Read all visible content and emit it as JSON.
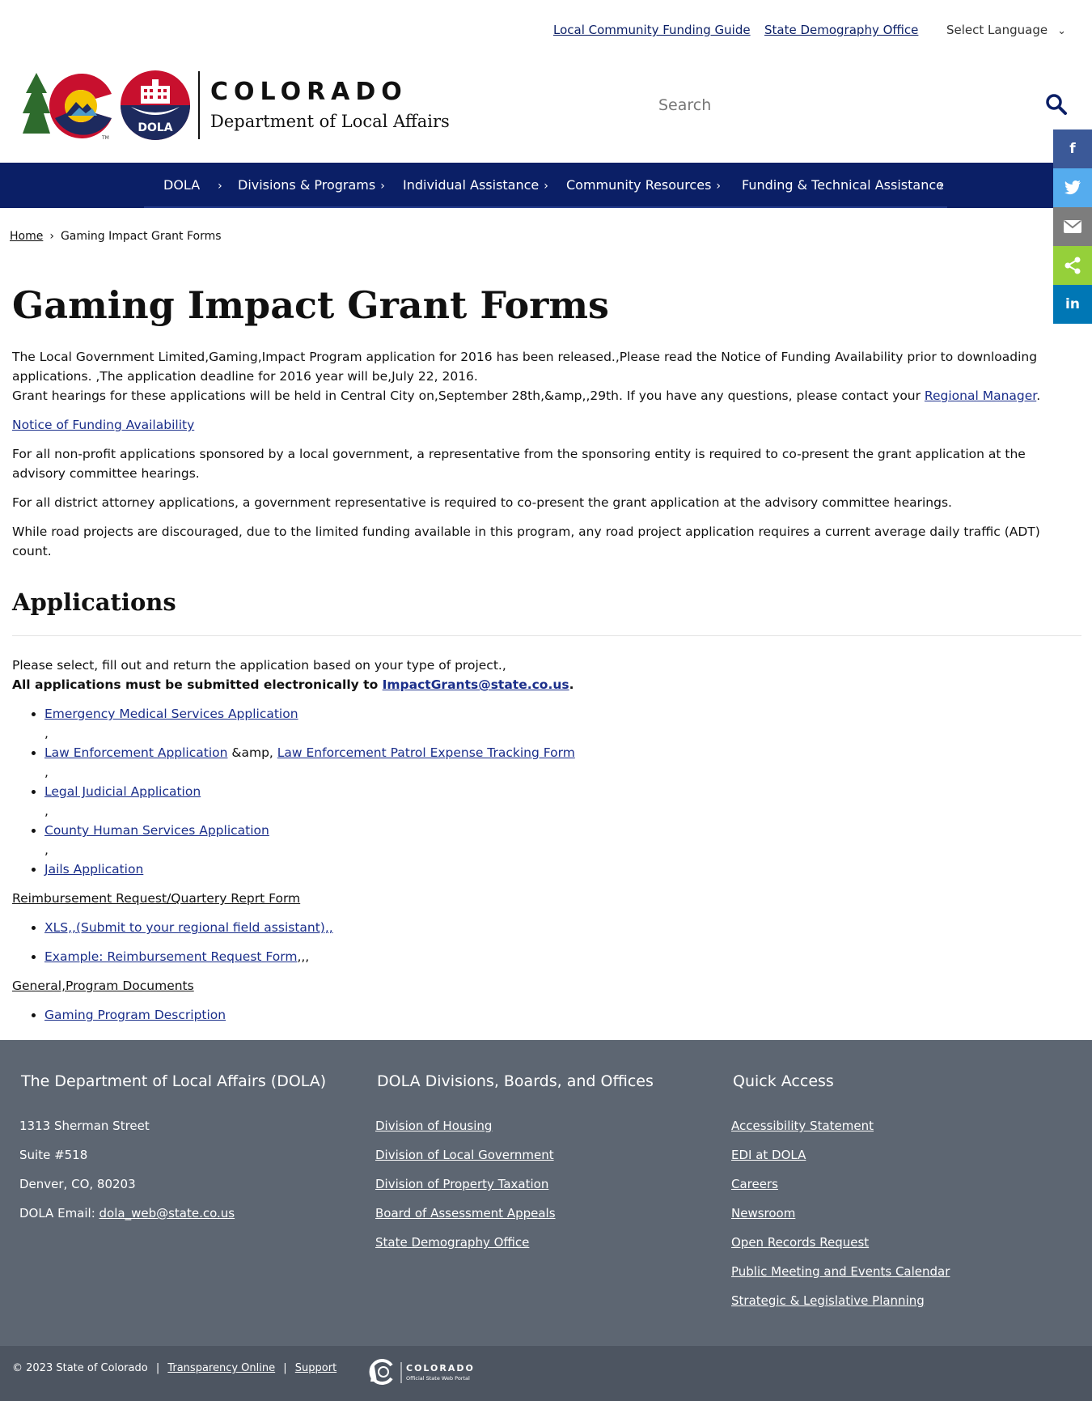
{
  "utility": {
    "link1": "Local Community Funding Guide",
    "link2": "State Demography Office",
    "language": "Select Language"
  },
  "header": {
    "wordmark": "COLORADO",
    "department": "Department of Local Affairs",
    "seal_text": "DOLA",
    "search_placeholder": "Search"
  },
  "nav": {
    "items": [
      {
        "label": "DOLA"
      },
      {
        "label": "Divisions & Programs"
      },
      {
        "label": "Individual Assistance"
      },
      {
        "label": "Community Resources"
      },
      {
        "label": "Funding & Technical Assistance"
      }
    ]
  },
  "share": {
    "facebook": "f",
    "linkedin": "in",
    "colors": {
      "facebook": "#3b5998",
      "twitter": "#55acee",
      "email": "#7d7d7d",
      "share": "#95d03a",
      "linkedin": "#0077b5"
    }
  },
  "breadcrumb": {
    "home": "Home",
    "current": "Gaming Impact Grant Forms"
  },
  "main": {
    "title": "Gaming Impact Grant Forms",
    "intro1": "The Local Government Limited,Gaming,Impact Program application for 2016 has been released.,Please read the Notice of Funding Availability prior to downloading applications. ,The application deadline for 2016 year will be,July 22, 2016.",
    "intro2_pre": "Grant hearings for these applications will be held in Central City on,September 28th,&amp,,29th. If you have any questions, please contact your ",
    "intro2_link": "Regional Manager",
    "intro2_post": ".",
    "nofa_link": "Notice of Funding Availability",
    "para_nonprofit": "For all non-profit applications sponsored by a local government, a representative from the sponsoring entity is required to co-present the grant application at the advisory committee hearings.",
    "para_da": "For all district attorney applications, a government representative is required to co-present the grant application at the advisory committee hearings.",
    "para_road": "While road projects are discouraged, due to the limited funding available in this program, any road project application requires a current average daily traffic (ADT) count.",
    "apps_heading": "Applications",
    "apps_select": "Please select, fill out and return the application based on your type of project.,",
    "apps_submit_pre": "All applications must be submitted electronically to ",
    "apps_submit_email": "ImpactGrants@state.co.us",
    "apps_submit_post": ".",
    "app_ems": "Emergency Medical Services Application",
    "app_le": "Law Enforcement Application",
    "app_le_mid": " &amp, ",
    "app_le_patrol": "Law Enforcement Patrol Expense Tracking Form",
    "app_legal": "Legal Judicial Application",
    "app_county": "County Human Services Application",
    "app_jails": "Jails Application",
    "comma": ",",
    "reimb_heading": "Reimbursement Request/Quartery Reprt Form",
    "reimb_xls": "XLS,,(Submit to your regional field assistant),,",
    "reimb_example": "Example: Reimbursement Request Form",
    "reimb_example_post": ",,,",
    "general_heading": "General,Program Documents",
    "gaming_desc": "Gaming Program Description"
  },
  "footer": {
    "col1": {
      "heading": "The Department of Local Affairs (DOLA)",
      "address1": "1313 Sherman Street",
      "address2": "Suite  #518",
      "address3": "Denver, CO, 80203",
      "email_label": "DOLA Email: ",
      "email": "dola_web@state.co.us"
    },
    "col2": {
      "heading": "DOLA Divisions, Boards, and Offices",
      "links": [
        "Division of Housing",
        "Division of Local Government",
        "Division of Property Taxation",
        "Board of Assessment Appeals",
        "State Demography Office"
      ]
    },
    "col3": {
      "heading": "Quick Access",
      "links": [
        "Accessibility Statement",
        "EDI at DOLA",
        "Careers",
        "Newsroom",
        "Open Records Request",
        "Public Meeting and Events Calendar",
        "Strategic & Legislative Planning"
      ]
    }
  },
  "bottom": {
    "copyright": "© 2023 State of Colorado",
    "sep": "|",
    "transparency": "Transparency Online",
    "support": "Support",
    "portal_title": "COLORADO",
    "portal_sub": "Official State Web Portal"
  }
}
